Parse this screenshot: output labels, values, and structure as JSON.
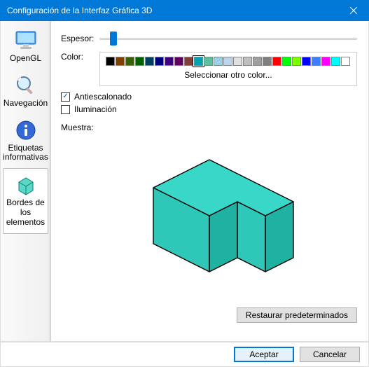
{
  "window": {
    "title": "Configuración de la Interfaz Gráfica 3D"
  },
  "sidebar": {
    "items": [
      {
        "label": "OpenGL"
      },
      {
        "label": "Navegación"
      },
      {
        "label": "Etiquetas informativas"
      },
      {
        "label": "Bordes de los elementos"
      }
    ]
  },
  "labels": {
    "thickness": "Espesor:",
    "color": "Color:",
    "more_color": "Seleccionar otro color...",
    "antialias": "Antiescalonado",
    "lighting": "Iluminación",
    "sample": "Muestra:"
  },
  "checks": {
    "antialias": true,
    "lighting": false
  },
  "slider": {
    "value_pct": 4
  },
  "buttons": {
    "restore": "Restaurar predeterminados",
    "ok": "Aceptar",
    "cancel": "Cancelar"
  },
  "palette": {
    "colors": [
      "#000000",
      "#7e3f00",
      "#3a5f0b",
      "#005f00",
      "#003f5f",
      "#00007f",
      "#3f007f",
      "#5f005f",
      "#7f3f3f",
      "#00a2b2",
      "#5fbf9f",
      "#9fcfe6",
      "#bfd4e8",
      "#dfdfdf",
      "#bfbfbf",
      "#9f9f9f",
      "#7f7f7f",
      "#ff0000",
      "#00ff00",
      "#7fff00",
      "#0000ff",
      "#3f7fff",
      "#ff00ff",
      "#00ffff",
      "#ffffff"
    ],
    "selected_index": 9
  },
  "shape": {
    "face_top": "#39d7c8",
    "face_left": "#2fc7b8",
    "face_right": "#1fb2a2",
    "edge": "#000000"
  }
}
